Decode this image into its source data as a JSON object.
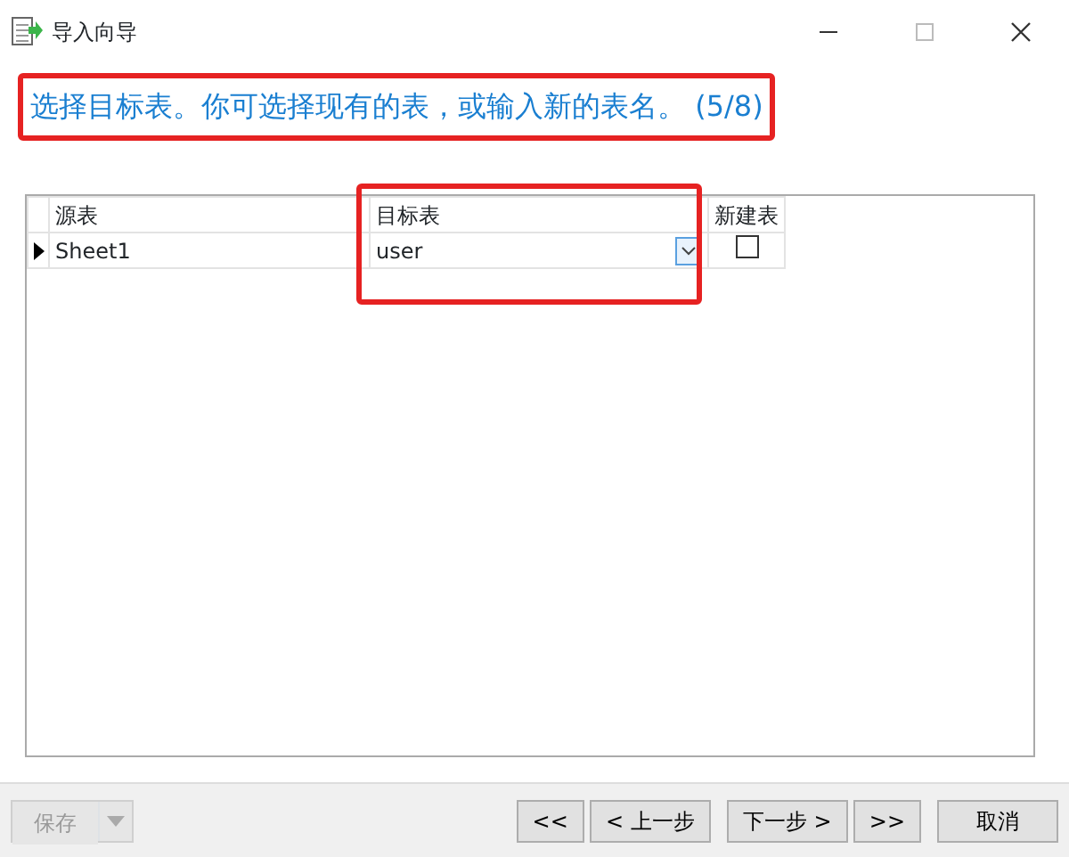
{
  "window": {
    "title": "导入向导"
  },
  "instruction": {
    "text": "选择目标表。你可选择现有的表，或输入新的表名。 (5/8)",
    "highlighted": true
  },
  "table": {
    "columns": [
      {
        "label": "源表",
        "highlighted": false
      },
      {
        "label": "目标表",
        "highlighted": true
      },
      {
        "label": "新建表",
        "highlighted": false
      }
    ],
    "rows": [
      {
        "current": true,
        "source": "Sheet1",
        "target": "user",
        "new_table": false
      }
    ]
  },
  "footer": {
    "save": {
      "label": "保存",
      "disabled": true
    },
    "buttons": [
      {
        "label": "<<",
        "disabled": false
      },
      {
        "label": "< 上一步",
        "disabled": false
      },
      {
        "label": "下一步 >",
        "disabled": false
      },
      {
        "label": ">>",
        "disabled": false
      },
      {
        "label": "取消",
        "disabled": false
      }
    ]
  }
}
